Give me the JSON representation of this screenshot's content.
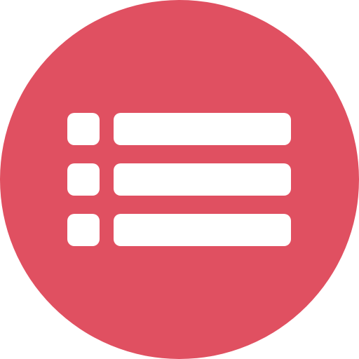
{
  "icon": {
    "name": "list-icon",
    "background_color": "#E05061",
    "glyph_color": "#FFFFFF",
    "rows": [
      {
        "bullet": "bullet-square",
        "line": "list-line"
      },
      {
        "bullet": "bullet-square",
        "line": "list-line"
      },
      {
        "bullet": "bullet-square",
        "line": "list-line"
      }
    ]
  }
}
